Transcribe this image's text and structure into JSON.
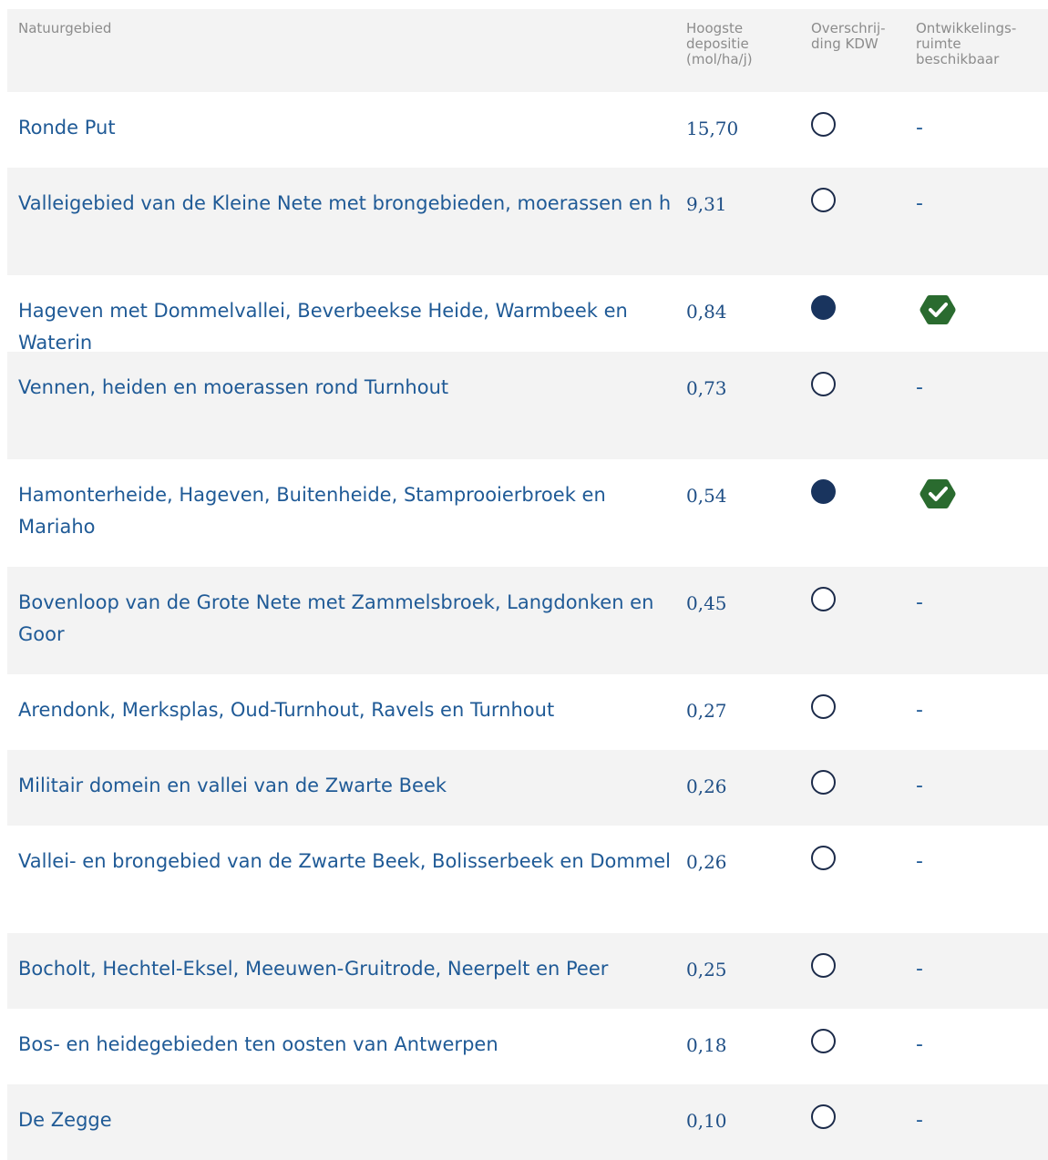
{
  "table": {
    "headers": {
      "name": "Natuurgebied",
      "deposition": [
        "Hoogste",
        "depositie",
        "(mol/ha/j)"
      ],
      "kdw": [
        "Overschrij-",
        "ding KDW"
      ],
      "ontwikkeling": [
        "Ontwikkelings-",
        "ruimte",
        "beschikbaar"
      ]
    },
    "rows": [
      {
        "name": "Ronde Put",
        "deposition": "15,70",
        "kdw_exceeded": false,
        "ontwikkelingsruimte": "-"
      },
      {
        "name": "Valleigebied van de Kleine Nete met brongebieden, moerassen en h",
        "deposition": "9,31",
        "kdw_exceeded": false,
        "ontwikkelingsruimte": "-"
      },
      {
        "name": "Hageven met Dommelvallei, Beverbeekse Heide, Warmbeek en Waterin",
        "deposition": "0,84",
        "kdw_exceeded": true,
        "ontwikkelingsruimte": "check"
      },
      {
        "name": "Vennen, heiden en moerassen rond Turnhout",
        "deposition": "0,73",
        "kdw_exceeded": false,
        "ontwikkelingsruimte": "-"
      },
      {
        "name": "Hamonterheide, Hageven, Buitenheide, Stamprooierbroek en Mariaho",
        "deposition": "0,54",
        "kdw_exceeded": true,
        "ontwikkelingsruimte": "check"
      },
      {
        "name": "Bovenloop van de Grote Nete met Zammelsbroek, Langdonken en Goor",
        "deposition": "0,45",
        "kdw_exceeded": false,
        "ontwikkelingsruimte": "-"
      },
      {
        "name": "Arendonk, Merksplas, Oud-Turnhout, Ravels en Turnhout",
        "deposition": "0,27",
        "kdw_exceeded": false,
        "ontwikkelingsruimte": "-"
      },
      {
        "name": "Militair domein en vallei van de Zwarte Beek",
        "deposition": "0,26",
        "kdw_exceeded": false,
        "ontwikkelingsruimte": "-"
      },
      {
        "name": "Vallei- en brongebied van de Zwarte Beek, Bolisserbeek en Dommel",
        "deposition": "0,26",
        "kdw_exceeded": false,
        "ontwikkelingsruimte": "-"
      },
      {
        "name": "Bocholt, Hechtel-Eksel, Meeuwen-Gruitrode, Neerpelt en Peer",
        "deposition": "0,25",
        "kdw_exceeded": false,
        "ontwikkelingsruimte": "-"
      },
      {
        "name": "Bos- en heidegebieden ten oosten van Antwerpen",
        "deposition": "0,18",
        "kdw_exceeded": false,
        "ontwikkelingsruimte": "-"
      },
      {
        "name": "De Zegge",
        "deposition": "0,10",
        "kdw_exceeded": false,
        "ontwikkelingsruimte": "-"
      }
    ]
  },
  "colors": {
    "header_bg": "#f3f3f3",
    "link_text": "#1f5a96",
    "status_filled": "#19345e",
    "check_green": "#2a6b2f"
  }
}
